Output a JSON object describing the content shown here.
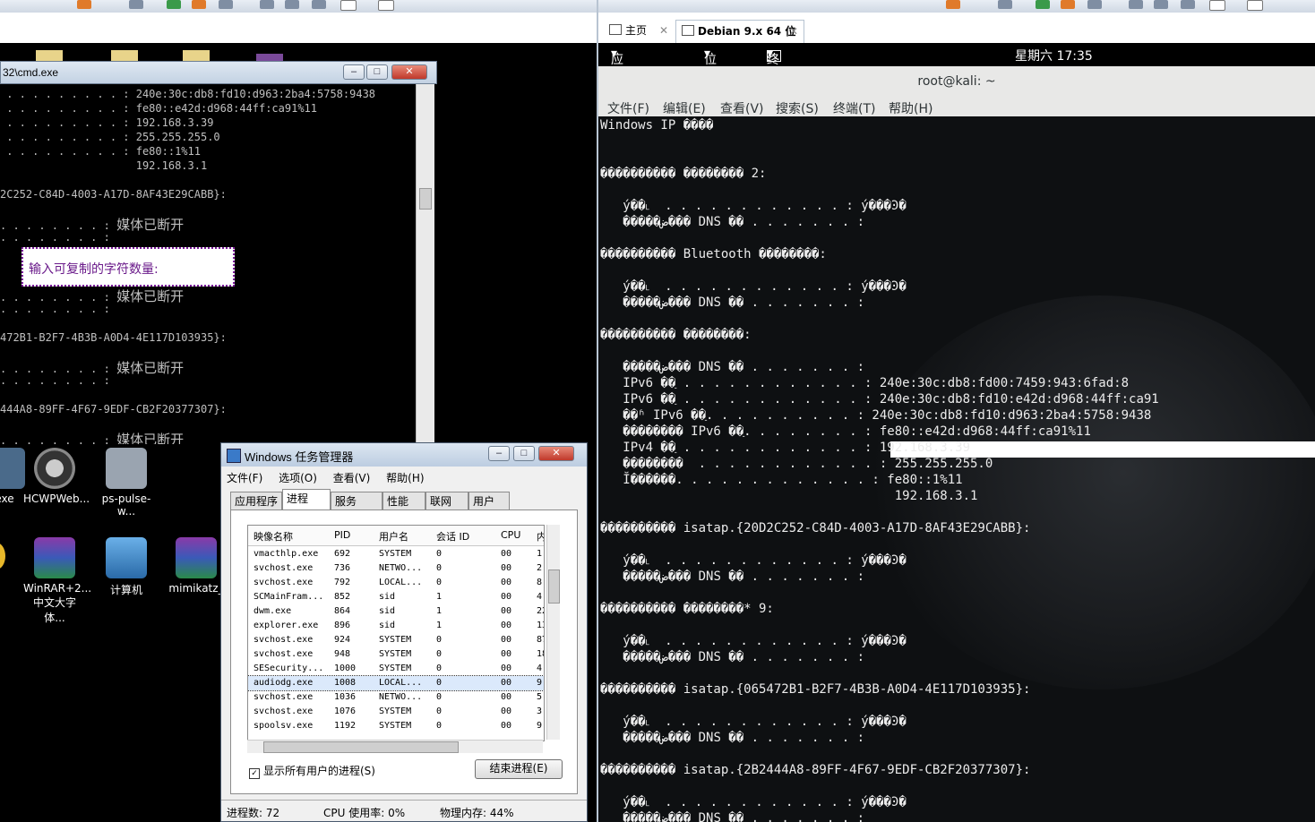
{
  "left_window": {
    "cmd_title": "32\\cmd.exe",
    "popup_text": "输入可复制的字符数量:",
    "lines": [
      {
        "dots": " . . . . . . . . . : ",
        "val": "240e:30c:db8:fd10:d963:2ba4:5758:9438"
      },
      {
        "dots": " . . . . . . . . . : ",
        "val": "fe80::e42d:d968:44ff:ca91%11"
      },
      {
        "dots": " . . . . . . . . . : ",
        "val": "192.168.3.39"
      },
      {
        "dots": " . . . . . . . . . : ",
        "val": "255.255.255.0"
      },
      {
        "dots": " . . . . . . . . . : ",
        "val": "fe80::1%11"
      },
      {
        "dots": "                     ",
        "val": "192.168.3.1"
      }
    ],
    "adapter1": "2C252-C84D-4003-A17D-8AF43E29CABB}:",
    "adapter2": "472B1-B2F7-4B3B-A0D4-4E117D103935}:",
    "adapter3": "444A8-89FF-4F67-9EDF-CB2F20377307}:",
    "media_disconnected": "媒体已断开",
    "dots_colon": ". . . . . . . . :"
  },
  "desktop_icons": [
    {
      "label": "exe"
    },
    {
      "label": "HCWPWeb..."
    },
    {
      "label": "ps-pulse-w..."
    },
    {
      "label": "WinRAR+2...\n中文大字体..."
    },
    {
      "label": "计算机"
    },
    {
      "label": "mimikatz_"
    }
  ],
  "task_manager": {
    "title": "Windows 任务管理器",
    "menu": [
      "文件(F)",
      "选项(O)",
      "查看(V)",
      "帮助(H)"
    ],
    "tabs": [
      "应用程序",
      "进程",
      "服务",
      "性能",
      "联网",
      "用户"
    ],
    "active_tab": "进程",
    "columns": [
      "映像名称",
      "PID",
      "用户名",
      "会话 ID",
      "CPU",
      "内"
    ],
    "rows": [
      [
        "vmacthlp.exe",
        "692",
        "SYSTEM",
        "0",
        "00",
        "1"
      ],
      [
        "svchost.exe",
        "736",
        "NETWO...",
        "0",
        "00",
        "2"
      ],
      [
        "svchost.exe",
        "792",
        "LOCAL...",
        "0",
        "00",
        "8"
      ],
      [
        "SCMainFram...",
        "852",
        "sid",
        "1",
        "00",
        "4"
      ],
      [
        "dwm.exe",
        "864",
        "sid",
        "1",
        "00",
        "22"
      ],
      [
        "explorer.exe",
        "896",
        "sid",
        "1",
        "00",
        "13"
      ],
      [
        "svchost.exe",
        "924",
        "SYSTEM",
        "0",
        "00",
        "87"
      ],
      [
        "svchost.exe",
        "948",
        "SYSTEM",
        "0",
        "00",
        "18"
      ],
      [
        "SESecurity...",
        "1000",
        "SYSTEM",
        "0",
        "00",
        "4"
      ],
      [
        "audiodg.exe",
        "1008",
        "LOCAL...",
        "0",
        "00",
        "9"
      ],
      [
        "svchost.exe",
        "1036",
        "NETWO...",
        "0",
        "00",
        "5"
      ],
      [
        "svchost.exe",
        "1076",
        "SYSTEM",
        "0",
        "00",
        "3"
      ],
      [
        "spoolsv.exe",
        "1192",
        "SYSTEM",
        "0",
        "00",
        "9"
      ]
    ],
    "selected_row": 9,
    "show_all_label": "显示所有用户的进程(S)",
    "end_button": "结束进程(E)",
    "status": {
      "processes": "进程数: 72",
      "cpu": "CPU 使用率: 0%",
      "memory": "物理内存: 44%"
    }
  },
  "vm": {
    "home_tab": "主页",
    "vm_tab": "Debian 9.x 64 位",
    "gnome": {
      "apps": "应用程序",
      "places": "位置",
      "terminal": "终端",
      "clock": "星期六 17:35"
    },
    "term_title": "root@kali: ~",
    "term_menu": [
      "文件(F)",
      "编辑(E)",
      "查看(V)",
      "搜索(S)",
      "终端(T)",
      "帮助(H)"
    ]
  },
  "terminal_lines": [
    "Windows IP ����",
    "",
    "",
    "���������� �������� 2:",
    "",
    "   ý��˪  . . . . . . . . . . . . : ý���Ͽ�",
    "   �����ض��� DNS ��׺ . . . . . . . :",
    "",
    "���������� Bluetooth ��������:",
    "",
    "   ý��˪  . . . . . . . . . . . . : ý���Ͽ�",
    "   �����ض��� DNS ��׺ . . . . . . . :",
    "",
    "���������� ��������:",
    "",
    "   �����ض��� DNS ��׺ . . . . . . . :",
    "   IPv6 ��ַ . . . . . . . . . . . . : 240e:30c:db8:fd00:7459:943:6fad:8",
    "   IPv6 ��ַ . . . . . . . . . . . . : 240e:30c:db8:fd10:e42d:d968:44ff:ca91",
    "   ��ʱ IPv6 ��ַ. . . . . . . . . . : 240e:30c:db8:fd10:d963:2ba4:5758:9438",
    "   �������� IPv6 ��ַ. . . . . . . . : fe80::e42d:d968:44ff:ca91%11",
    "   IPv4 ��ַ . . . . . . . . . . . . : 192.168.3.39",
    "   ��������  . . . . . . . . . . . . : 255.255.255.0",
    "   Ĭ������. . . . . . . . . . . . . : fe80::1%11",
    "                                       192.168.3.1",
    "",
    "���������� isatap.{20D2C252-C84D-4003-A17D-8AF43E29CABB}:",
    "",
    "   ý��˪  . . . . . . . . . . . . : ý���Ͽ�",
    "   �����ض��� DNS ��׺ . . . . . . . :",
    "",
    "���������� ��������* 9:",
    "",
    "   ý��˪  . . . . . . . . . . . . : ý���Ͽ�",
    "   �����ض��� DNS ��׺ . . . . . . . :",
    "",
    "���������� isatap.{065472B1-B2F7-4B3B-A0D4-4E117D103935}:",
    "",
    "   ý��˪  . . . . . . . . . . . . : ý���Ͽ�",
    "   �����ض��� DNS ��׺ . . . . . . . :",
    "",
    "���������� isatap.{2B2444A8-89FF-4F67-9EDF-CB2F20377307}:",
    "",
    "   ý��˪  . . . . . . . . . . . . : ý���Ͽ�",
    "   �����ض��� DNS ��׺ . . . . . . . :"
  ],
  "highlight_line": 20
}
